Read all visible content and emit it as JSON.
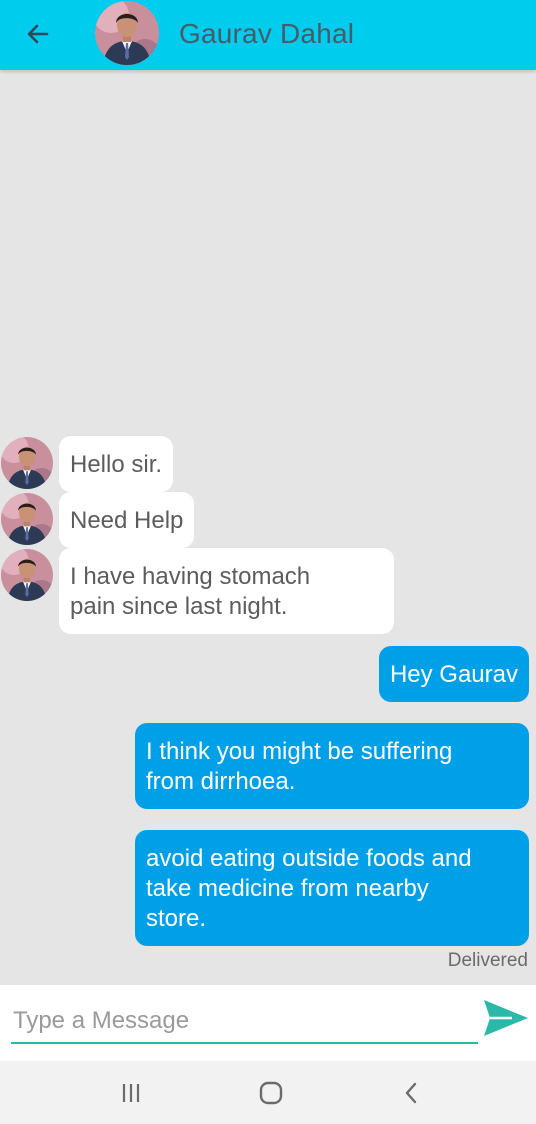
{
  "header": {
    "contact_name": "Gaurav Dahal",
    "back_icon": "arrow-left-icon",
    "avatar_icon": "contact-avatar"
  },
  "messages": [
    {
      "direction": "incoming",
      "lines": [
        "Hello sir."
      ]
    },
    {
      "direction": "incoming",
      "lines": [
        "Need Help"
      ]
    },
    {
      "direction": "incoming",
      "lines": [
        "I have having stomach",
        "pain since last night."
      ]
    },
    {
      "direction": "outgoing",
      "lines": [
        "Hey Gaurav"
      ]
    },
    {
      "direction": "outgoing",
      "lines": [
        "I think you might be suffering",
        "from dirrhoea."
      ]
    },
    {
      "direction": "outgoing",
      "lines": [
        "avoid eating outside foods and",
        "take medicine from nearby",
        "store."
      ]
    }
  ],
  "status": "Delivered",
  "composer": {
    "placeholder": "Type a Message",
    "value": "",
    "send_icon": "send-icon"
  },
  "navigation": {
    "recents_icon": "recents-icon",
    "home_icon": "home-icon",
    "back_icon": "back-chevron-icon"
  },
  "colors": {
    "header": "#00ccee",
    "outgoing_bubble": "#00a0e8",
    "incoming_bubble": "#ffffff",
    "chat_background": "#e5e5e5",
    "send": "#2bb8a8"
  }
}
